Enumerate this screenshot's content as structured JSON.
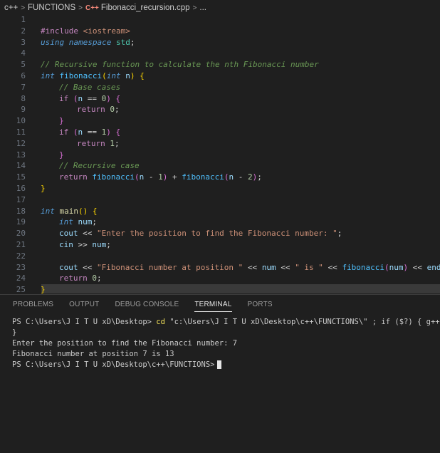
{
  "breadcrumb": {
    "root": "c++",
    "folder": "FUNCTIONS",
    "file_icon_text": "C++",
    "file": "Fibonacci_recursion.cpp",
    "trail": "..."
  },
  "editor": {
    "line_numbers": [
      "1",
      "2",
      "3",
      "4",
      "5",
      "6",
      "7",
      "8",
      "9",
      "10",
      "11",
      "12",
      "13",
      "14",
      "15",
      "16",
      "17",
      "18",
      "19",
      "20",
      "21",
      "22",
      "23",
      "24",
      "25"
    ],
    "lines": {
      "l1_a": "#include ",
      "l1_b": "<iostream>",
      "l2_a": "using",
      "l2_b": "namespace",
      "l2_c": "std",
      "l4": "// Recursive function to calculate the nth Fibonacci number",
      "l5_a": "int",
      "l5_b": "fibonacci",
      "l5_c": "int",
      "l5_d": "n",
      "l6": "// Base cases",
      "l7_a": "if",
      "l7_b": "n",
      "l7_c": "0",
      "l8_a": "return",
      "l8_b": "0",
      "l10_a": "if",
      "l10_b": "n",
      "l10_c": "1",
      "l11_a": "return",
      "l11_b": "1",
      "l13": "// Recursive case",
      "l14_a": "return",
      "l14_b": "fibonacci",
      "l14_c": "n",
      "l14_d": "1",
      "l14_e": "fibonacci",
      "l14_f": "n",
      "l14_g": "2",
      "l17_a": "int",
      "l17_b": "main",
      "l18_a": "int",
      "l18_b": "num",
      "l19_a": "cout",
      "l19_b": "\"Enter the position to find the Fibonacci number: \"",
      "l20_a": "cin",
      "l20_b": "num",
      "l22_a": "cout",
      "l22_b": "\"Fibonacci number at position \"",
      "l22_c": "num",
      "l22_d": "\" is \"",
      "l22_e": "fibonacci",
      "l22_f": "num",
      "l22_g": "endl",
      "l23_a": "return",
      "l23_b": "0"
    }
  },
  "panel": {
    "tabs": [
      "PROBLEMS",
      "OUTPUT",
      "DEBUG CONSOLE",
      "TERMINAL",
      "PORTS"
    ],
    "active_tab": "TERMINAL"
  },
  "terminal": {
    "prompt1": "PS C:\\Users\\J I T U xD\\Desktop> ",
    "cmd_cd": "cd",
    "cmd_path": " \"c:\\Users\\J I T U xD\\Desktop\\c++\\FUNCTIONS\\\"",
    "cmd_rest": " ; if ($?) { g++ Fibonacci_recursion.cpp -o Fibonacci_recursion } ; if ($?) { .\\Fibonacci_recursion }",
    "line2": "}",
    "line3": "Enter the position to find the Fibonacci number: 7",
    "line4": "Fibonacci number at position 7 is 13",
    "prompt2": "PS C:\\Users\\J I T U xD\\Desktop\\c++\\FUNCTIONS>"
  }
}
